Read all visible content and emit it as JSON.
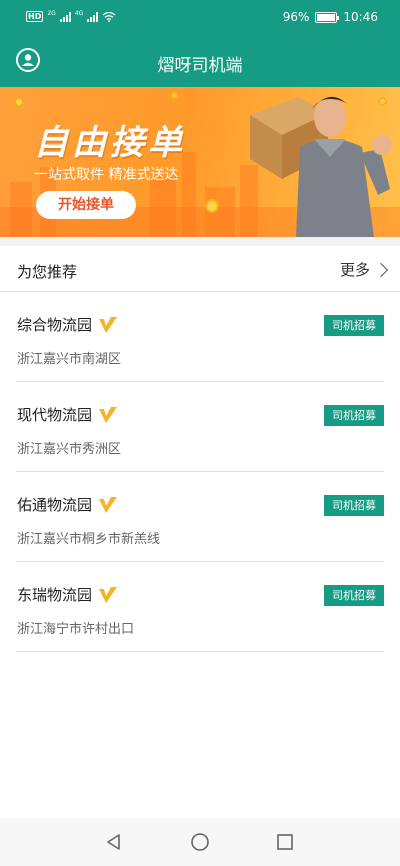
{
  "status_bar": {
    "hd_label": "HD",
    "net1": "2G",
    "net2": "4G",
    "battery_text": "96%",
    "battery_level": 0.96,
    "time": "10:46"
  },
  "header": {
    "title": "熠呀司机端",
    "avatar_icon": "user-circle-icon"
  },
  "banner": {
    "title": "自由接单",
    "subtitle": "一站式取件 精准式送达",
    "button_label": "开始接单",
    "colors": {
      "start": "#ffa03a",
      "end": "#ffc14a",
      "button_text": "#e8552a"
    }
  },
  "recommend": {
    "title": "为您推荐",
    "more_label": "更多",
    "items": [
      {
        "name": "综合物流园",
        "address": "浙江嘉兴市南湖区",
        "badge": "司机招募",
        "verified_icon": "verified-v-icon"
      },
      {
        "name": "现代物流园",
        "address": "浙江嘉兴市秀洲区",
        "badge": "司机招募",
        "verified_icon": "verified-v-icon"
      },
      {
        "name": "佑通物流园",
        "address": "浙江嘉兴市桐乡市新羔线",
        "badge": "司机招募",
        "verified_icon": "verified-v-icon"
      },
      {
        "name": "东瑞物流园",
        "address": "浙江海宁市许村出口",
        "badge": "司机招募",
        "verified_icon": "verified-v-icon"
      }
    ]
  },
  "nav": {
    "icons": [
      "back-icon",
      "home-icon",
      "recents-icon"
    ]
  },
  "colors": {
    "accent": "#169b85",
    "verified": "#f5b326"
  }
}
